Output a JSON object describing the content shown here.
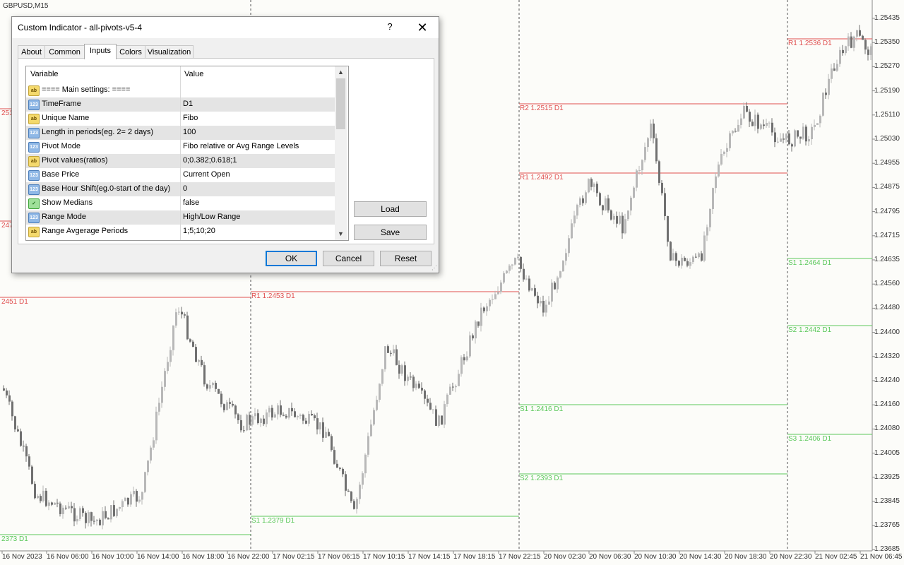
{
  "chart": {
    "title": "GBPUSD,M15",
    "price_axis": [
      "1.25435",
      "1.25350",
      "1.25270",
      "1.25190",
      "1.25110",
      "1.25030",
      "1.24955",
      "1.24875",
      "1.24795",
      "1.24715",
      "1.24635",
      "1.24560",
      "1.24480",
      "1.24400",
      "1.24320",
      "1.24240",
      "1.24160",
      "1.24080",
      "1.24005",
      "1.23925",
      "1.23845",
      "1.23765",
      "1.23685"
    ],
    "time_axis": [
      "16 Nov 2023",
      "16 Nov 06:00",
      "16 Nov 10:00",
      "16 Nov 14:00",
      "16 Nov 18:00",
      "16 Nov 22:00",
      "17 Nov 02:15",
      "17 Nov 06:15",
      "17 Nov 10:15",
      "17 Nov 14:15",
      "17 Nov 18:15",
      "17 Nov 22:15",
      "20 Nov 02:30",
      "20 Nov 06:30",
      "20 Nov 10:30",
      "20 Nov 14:30",
      "20 Nov 18:30",
      "20 Nov 22:30",
      "21 Nov 02:45",
      "21 Nov 06:45"
    ],
    "pivot_labels": [
      {
        "text": "R1 1.2536 D1",
        "kind": "resistance"
      },
      {
        "text": "R2 1.2515 D1",
        "kind": "resistance"
      },
      {
        "text": "R1 1.2492 D1",
        "kind": "resistance"
      },
      {
        "text": "R1 1.2453 D1",
        "kind": "resistance"
      },
      {
        "text": "2451 D1",
        "kind": "resistance"
      },
      {
        "text": "251",
        "kind": "resistance"
      },
      {
        "text": "247",
        "kind": "resistance"
      },
      {
        "text": "S1 1.2464 D1",
        "kind": "support"
      },
      {
        "text": "S2 1.2442 D1",
        "kind": "support"
      },
      {
        "text": "S1 1.2416 D1",
        "kind": "support"
      },
      {
        "text": "S3 1.2406 D1",
        "kind": "support"
      },
      {
        "text": "S2 1.2393 D1",
        "kind": "support"
      },
      {
        "text": "S1 1.2379 D1",
        "kind": "support"
      },
      {
        "text": "2373 D1",
        "kind": "support"
      }
    ],
    "colors": {
      "resistance": "#e05050",
      "support": "#5cc85c",
      "candle_up": "#b8b8b8",
      "candle_down": "#707070"
    }
  },
  "dialog": {
    "title": "Custom Indicator - all-pivots-v5-4",
    "help_label": "?",
    "close_label": "✕",
    "tabs": [
      "About",
      "Common",
      "Inputs",
      "Colors",
      "Visualization"
    ],
    "active_tab": "Inputs",
    "grid": {
      "headers": {
        "variable": "Variable",
        "value": "Value"
      },
      "rows": [
        {
          "type": "ab",
          "variable": "==== Main settings: ====",
          "value": ""
        },
        {
          "type": "num",
          "variable": "TimeFrame",
          "value": "D1"
        },
        {
          "type": "ab",
          "variable": "Unique Name",
          "value": "Fibo"
        },
        {
          "type": "num",
          "variable": "Length in periods(eg. 2= 2 days)",
          "value": "100"
        },
        {
          "type": "num",
          "variable": "Pivot Mode",
          "value": "Fibo relative or Avg Range Levels"
        },
        {
          "type": "ab",
          "variable": "Pivot values(ratios)",
          "value": "0;0.382;0.618;1"
        },
        {
          "type": "num",
          "variable": "Base Price",
          "value": "Current Open"
        },
        {
          "type": "num",
          "variable": "Base Hour Shift(eg.0-start of the day)",
          "value": "0"
        },
        {
          "type": "bool",
          "variable": "Show Medians",
          "value": "false"
        },
        {
          "type": "num",
          "variable": "Range Mode",
          "value": "High/Low Range"
        },
        {
          "type": "ab",
          "variable": "Range Avgerage Periods",
          "value": "1;5;10;20"
        }
      ]
    },
    "buttons": {
      "load": "Load",
      "save": "Save",
      "ok": "OK",
      "cancel": "Cancel",
      "reset": "Reset"
    },
    "icon_text": {
      "ab": "ab",
      "num": "123",
      "bool": "✓"
    }
  }
}
